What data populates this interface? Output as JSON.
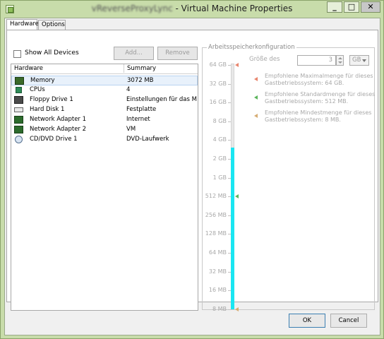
{
  "window": {
    "title_vm_name": "vReverseProxyLync",
    "title_text": " - Virtual Machine Properties",
    "buttons": {
      "minimize": "_",
      "maximize": "□",
      "close": "✕"
    }
  },
  "tabs": [
    {
      "label": "Hardware",
      "active": true
    },
    {
      "label": "Options",
      "active": false
    }
  ],
  "toolbar": {
    "show_all_devices": "Show All Devices",
    "add_label": "Add...",
    "remove_label": "Remove"
  },
  "hardware_list": {
    "columns": [
      "Hardware",
      "Summary"
    ],
    "rows": [
      {
        "icon": "memory-icon",
        "name": "Memory",
        "summary": "3072 MB",
        "selected": true
      },
      {
        "icon": "cpu-icon",
        "name": "CPUs",
        "summary": "4"
      },
      {
        "icon": "floppy-icon",
        "name": "Floppy Drive 1",
        "summary": "Einstellungen für das M..."
      },
      {
        "icon": "hard-disk-icon",
        "name": "Hard Disk 1",
        "summary": "Festplatte"
      },
      {
        "icon": "network-adapter-icon",
        "name": "Network Adapter 1",
        "summary": "Internet"
      },
      {
        "icon": "network-adapter-icon",
        "name": "Network Adapter 2",
        "summary": "VM"
      },
      {
        "icon": "cd-dvd-icon",
        "name": "CD/DVD Drive 1",
        "summary": "DVD-Laufwerk"
      }
    ]
  },
  "memory_config": {
    "group_title": "Arbeitsspeicherkonfiguration",
    "scale_labels": [
      "64 GB",
      "32 GB",
      "16 GB",
      "8 GB",
      "4 GB",
      "2 GB",
      "1 GB",
      "512 MB",
      "256 MB",
      "128 MB",
      "64 MB",
      "32 MB",
      "16 MB",
      "8 MB"
    ],
    "size_label": "Größe des",
    "size_value": "3",
    "size_unit": "GB",
    "fill_level_gb": 3,
    "recommendations": [
      {
        "kind": "max",
        "color": "#e8856d",
        "line1": "Empfohlene Maximalmenge für dieses",
        "line2": "Gastbetriebssystem: 64 GB."
      },
      {
        "kind": "default",
        "color": "#5bb55b",
        "line1": "Empfohlene Standardmenge für dieses",
        "line2": "Gastbetriebssystem: 512 MB."
      },
      {
        "kind": "min",
        "color": "#d6ac72",
        "line1": "Empfohlene Mindestmenge für dieses",
        "line2": "Gastbetriebssystem: 8 MB."
      }
    ]
  },
  "footer": {
    "ok_label": "OK",
    "cancel_label": "Cancel"
  },
  "colors": {
    "accent_fill": "#19e6f2",
    "window_frame": "#c8dcaa"
  }
}
